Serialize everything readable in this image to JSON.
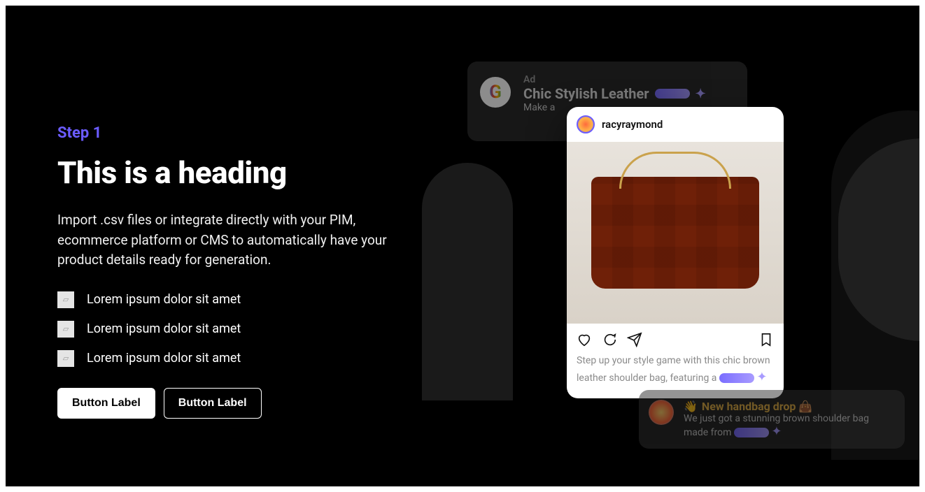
{
  "left": {
    "step": "Step 1",
    "heading": "This is a heading",
    "description": "Import .csv files or integrate directly with your PIM, ecommerce platform or CMS to automatically have your product details ready for generation.",
    "bullets": [
      "Lorem ipsum dolor sit amet",
      "Lorem ipsum dolor sit amet",
      "Lorem ipsum dolor sit amet"
    ],
    "primary_button": "Button Label",
    "secondary_button": "Button Label"
  },
  "ad": {
    "badge": "Ad",
    "title": "Chic Stylish Leather",
    "subtitle": "Make a"
  },
  "instagram": {
    "username": "racyraymond",
    "caption": "Step up your style game with this chic brown leather shoulder bag, featuring a"
  },
  "chat": {
    "title": "New handbag drop 👜",
    "body": "We just got a stunning brown shoulder bag made from"
  }
}
